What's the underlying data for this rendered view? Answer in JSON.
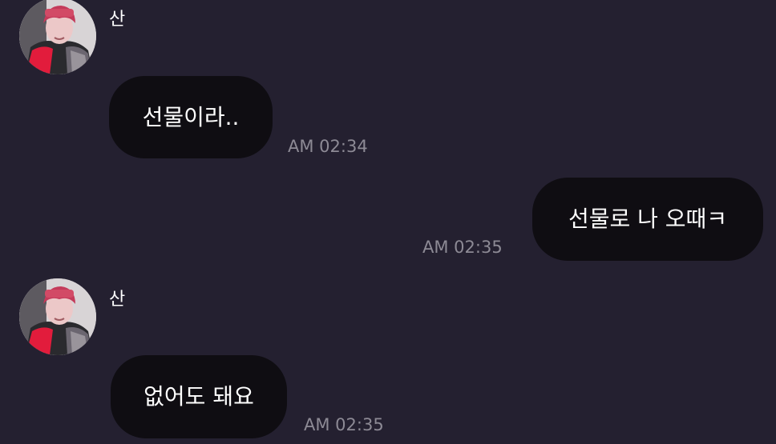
{
  "theme": {
    "background": "#242030",
    "bubble_color": "#0f0d12",
    "text_color": "#ffffff",
    "timestamp_color": "#8d8a95"
  },
  "messages": [
    {
      "direction": "incoming",
      "sender": "산",
      "avatar": "profile-photo",
      "text": "선물이라..",
      "time": "AM 02:34"
    },
    {
      "direction": "outgoing",
      "text": "선물로 나 오때ㅋ",
      "time": "AM 02:35"
    },
    {
      "direction": "incoming",
      "sender": "산",
      "avatar": "profile-photo",
      "text": "없어도 돼요",
      "time": "AM 02:35"
    }
  ]
}
